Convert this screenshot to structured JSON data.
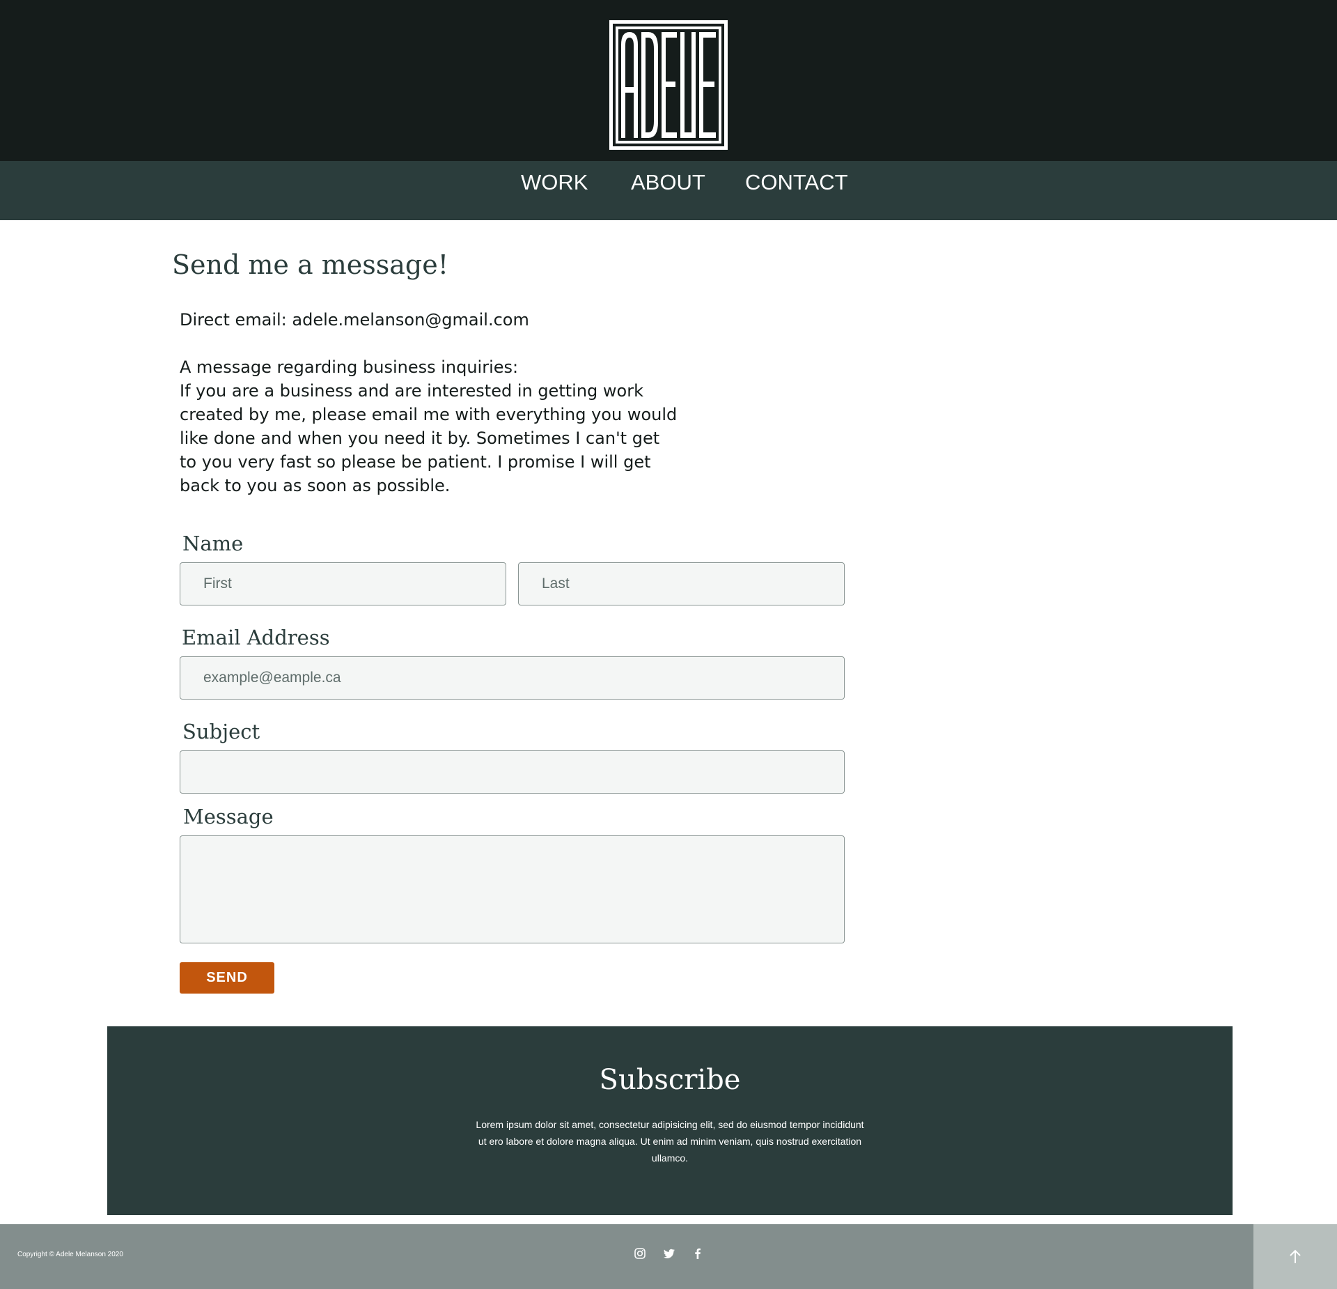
{
  "header": {
    "logo_text": "ADELE"
  },
  "nav": {
    "items": [
      {
        "label": "WORK"
      },
      {
        "label": "ABOUT"
      },
      {
        "label": "CONTACT"
      }
    ]
  },
  "contact": {
    "title": "Send me a message!",
    "direct_email": "Direct email: adele.melanson@gmail.com",
    "business_heading": "A message regarding business inquiries:",
    "business_text": "If you are a business and are interested in getting work created by me, please email me with everything you would like done and when you need it by. Sometimes I can't get to you very fast so please be patient. I promise I will get back to you as soon as possible."
  },
  "form": {
    "name_label": "Name",
    "first_placeholder": "First",
    "last_placeholder": "Last",
    "email_label": "Email Address",
    "email_placeholder": "example@eample.ca",
    "subject_label": "Subject",
    "message_label": "Message",
    "send_label": "SEND"
  },
  "subscribe": {
    "title": "Subscribe",
    "text": "Lorem ipsum dolor sit amet, consectetur adipisicing elit, sed do eiusmod tempor incididunt ut ero labore et dolore magna aliqua. Ut enim ad minim veniam, quis nostrud exercitation ullamco."
  },
  "footer": {
    "copyright": "Copyright © Adele Melanson 2020",
    "social_icons": [
      "instagram-icon",
      "twitter-icon",
      "facebook-icon"
    ],
    "back_to_top_icon": "arrow-up-icon"
  },
  "colors": {
    "header_bg": "#151c1b",
    "nav_bg": "#2b3d3c",
    "accent": "#c2560d",
    "footer_bg": "#838e8d",
    "back_to_top_bg": "#b7bfbd"
  }
}
